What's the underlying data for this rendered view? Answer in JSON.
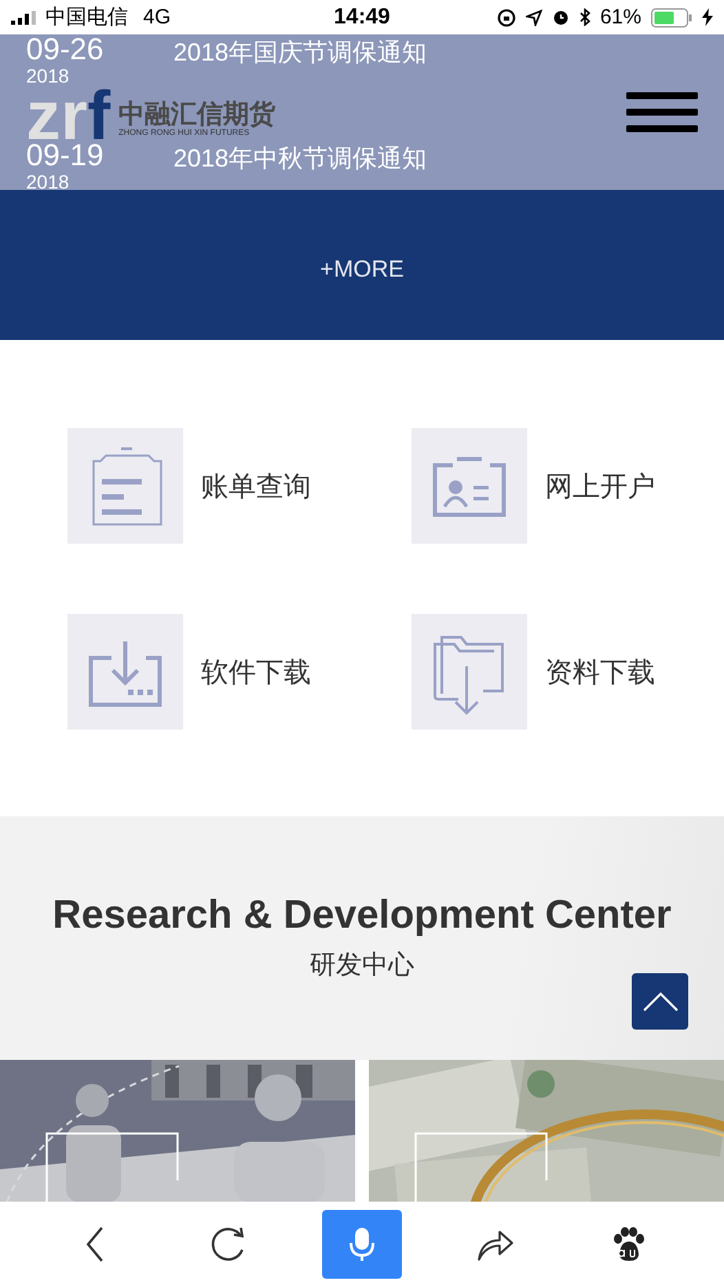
{
  "status_bar": {
    "carrier": "中国电信",
    "network": "4G",
    "time": "14:49",
    "battery": "61%"
  },
  "header": {
    "logo_mark": "zrf",
    "logo_name": "中融汇信期货",
    "logo_tagline": "ZHONG RONG HUI XIN FUTURES"
  },
  "news": [
    {
      "date": "09-26",
      "year": "2018",
      "title": "2018年国庆节调保通知"
    },
    {
      "date": "09-19",
      "year": "2018",
      "title": "2018年中秋节调保通知"
    }
  ],
  "more_link": "+MORE",
  "services": [
    {
      "kind": "clipboard",
      "label": "账单查询"
    },
    {
      "kind": "idcard",
      "label": "网上开户"
    },
    {
      "kind": "download",
      "label": "软件下载"
    },
    {
      "kind": "folder",
      "label": "资料下载"
    }
  ],
  "rd_section": {
    "title": "Research & Development Center",
    "subtitle": "研发中心"
  },
  "toolbar": [
    {
      "kind": "back",
      "highlighted": false
    },
    {
      "kind": "refresh",
      "highlighted": false
    },
    {
      "kind": "voice",
      "highlighted": true
    },
    {
      "kind": "share",
      "highlighted": false
    },
    {
      "kind": "paw",
      "highlighted": false
    }
  ]
}
